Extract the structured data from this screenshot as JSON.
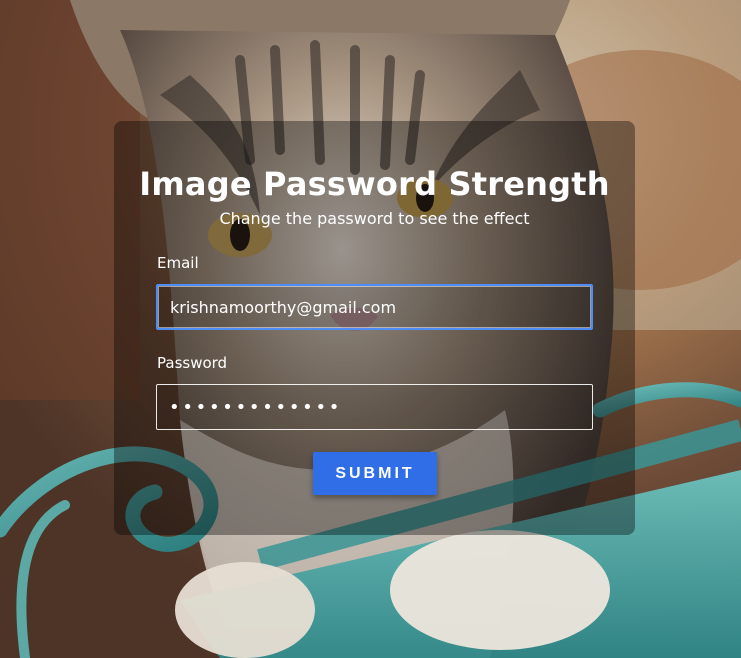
{
  "background": {
    "image": "cat-photo"
  },
  "form": {
    "title": "Image Password Strength",
    "subtitle": "Change the password to see the effect",
    "email_label": "Email",
    "email_value": "krishnamoorthy@gmail.com",
    "password_label": "Password",
    "password_value": "•••••••••••••",
    "submit_label": "SUBMIT"
  },
  "colors": {
    "accent": "#2f6ee6",
    "focus_border": "#4d8df5"
  }
}
